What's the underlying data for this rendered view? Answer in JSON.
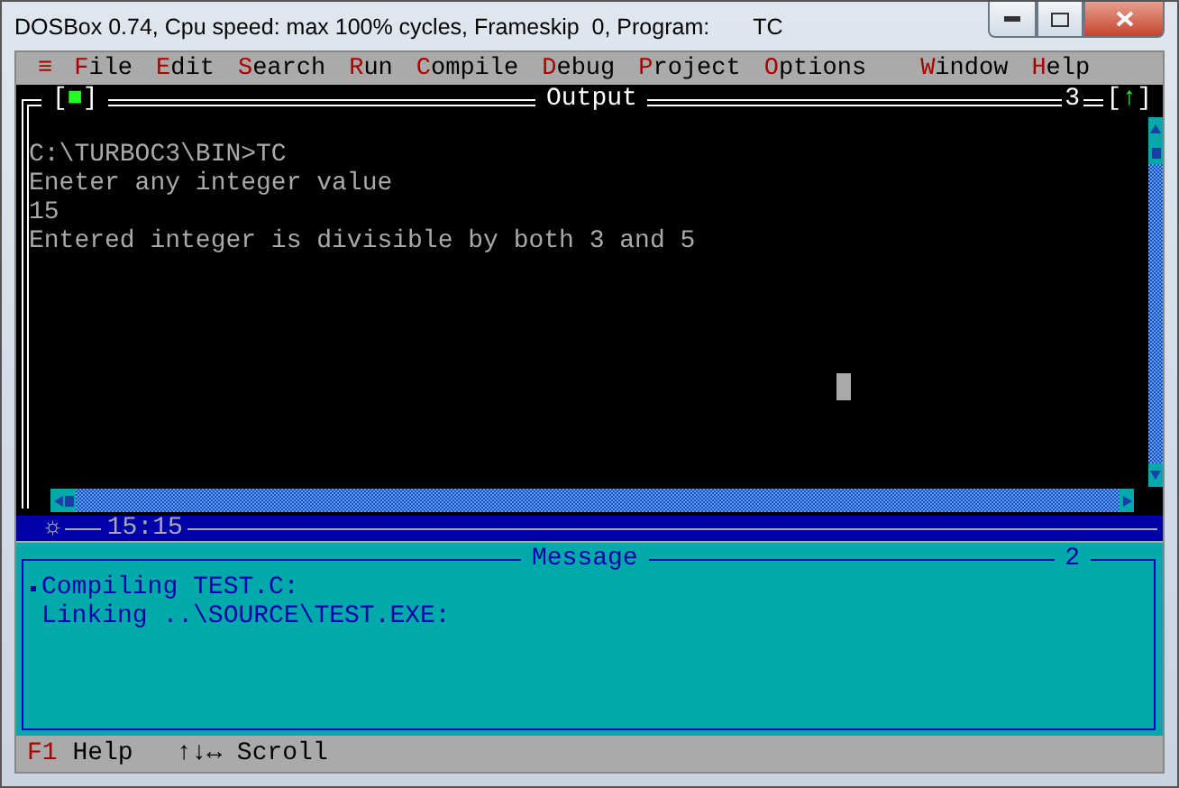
{
  "window": {
    "title": "DOSBox 0.74, Cpu speed: max 100% cycles, Frameskip  0, Program:       TC"
  },
  "menu": [
    {
      "hotkey": "≡"
    },
    {
      "hotkey": "F",
      "rest": "ile"
    },
    {
      "hotkey": "E",
      "rest": "dit"
    },
    {
      "hotkey": "S",
      "rest": "earch"
    },
    {
      "hotkey": "R",
      "rest": "un"
    },
    {
      "hotkey": "C",
      "rest": "ompile"
    },
    {
      "hotkey": "D",
      "rest": "ebug"
    },
    {
      "hotkey": "P",
      "rest": "roject"
    },
    {
      "hotkey": "O",
      "rest": "ptions"
    },
    {
      "hotkey": "W",
      "rest": "indow"
    },
    {
      "hotkey": "H",
      "rest": "elp"
    }
  ],
  "output_window": {
    "title": "Output",
    "number": "3",
    "close_box": {
      "left": "[",
      "glyph": "■",
      "right": "]"
    },
    "zoom_box": {
      "left": "[",
      "glyph": "↑",
      "right": "]"
    },
    "lines": [
      "C:\\TURBOC3\\BIN>TC",
      "Eneter any integer value",
      "15",
      "Entered integer is divisible by both 3 and 5"
    ],
    "status": "15:15",
    "status_mark": "☼"
  },
  "message_window": {
    "title": "Message",
    "number": "2",
    "lines": [
      {
        "text": "Compiling TEST.C:",
        "selected": true
      },
      {
        "text": "Linking ..\\SOURCE\\TEST.EXE:",
        "selected": false
      }
    ]
  },
  "status_bar": [
    {
      "key": "F1",
      "label": "Help"
    },
    {
      "label": "↑↓↔ Scroll"
    }
  ]
}
